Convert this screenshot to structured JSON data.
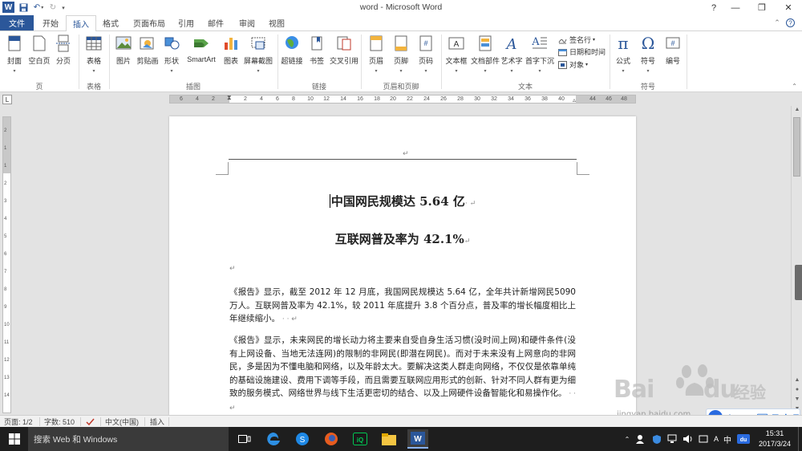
{
  "window": {
    "title": "word  -  Microsoft Word",
    "minimize": "—",
    "restore": "❐",
    "close": "✕",
    "help": "?"
  },
  "tabs": [
    "文件",
    "开始",
    "插入",
    "格式",
    "页面布局",
    "引用",
    "邮件",
    "审阅",
    "视图"
  ],
  "ribbon": {
    "groups": {
      "pages": "页",
      "tables": "表格",
      "illustrations": "插图",
      "links": "链接",
      "header_footer": "页眉和页脚",
      "text": "文本",
      "symbols": "符号"
    },
    "buttons": {
      "cover": "封面",
      "blank_page": "空白页",
      "page_break": "分页",
      "table": "表格",
      "picture": "图片",
      "clip_art": "剪贴画",
      "shapes": "形状",
      "smartart": "SmartArt",
      "chart": "图表",
      "screenshot": "屏幕截图",
      "hyperlink": "超链接",
      "bookmark": "书签",
      "cross_reference": "交叉引用",
      "header": "页眉",
      "footer": "页脚",
      "page_number": "页码",
      "text_box": "文本框",
      "quick_parts": "文档部件",
      "wordart": "艺术字",
      "drop_cap": "首字下沉",
      "signature_line": "签名行",
      "date_time": "日期和时间",
      "object": "对象",
      "equation": "公式",
      "symbol": "符号",
      "numbering": "编号"
    }
  },
  "ruler": {
    "h_ticks": [
      "6",
      "4",
      "2",
      "2",
      "4",
      "6",
      "8",
      "10",
      "12",
      "14",
      "16",
      "18",
      "20",
      "22",
      "24",
      "26",
      "28",
      "30",
      "32",
      "34",
      "36",
      "38",
      "40",
      "44",
      "46",
      "48"
    ],
    "v_ticks": [
      "2",
      "1",
      "1",
      "2",
      "3",
      "4",
      "5",
      "6",
      "7",
      "8",
      "9",
      "10",
      "11",
      "12",
      "13",
      "14"
    ]
  },
  "document": {
    "title": "中国网民规模达 5.64 亿",
    "subtitle": "互联网普及率为 42.1%",
    "para1": "《报告》显示，截至 2012 年 12 月底，我国网民规模达 5.64 亿，全年共计新增网民5090 万人。互联网普及率为 42.1%，较 2011 年底提升 3.8 个百分点，普及率的增长幅度相比上年继续缩小。",
    "para2": "《报告》显示，未来网民的增长动力将主要来自受自身生活习惯(没时间上网)和硬件条件(没有上网设备、当地无法连网)的限制的非网民(即潜在网民)。而对于未来没有上网意向的非网民，多是因为不懂电脑和网络，以及年龄太大。要解决这类人群走向网络，不仅仅是依靠单纯的基础设施建设、费用下调等手段，而且需要互联网应用形式的创新、针对不同人群有更为细致的服务模式、网络世界与线下生活更密切的结合、以及上网硬件设备智能化和易操作化。",
    "para_mark": "↵"
  },
  "status": {
    "page": "页面: 1/2",
    "words": "字数: 510",
    "language": "中文(中国)",
    "insert_mode": "插入"
  },
  "taskbar": {
    "search_placeholder": "搜索 Web 和 Windows",
    "time": "15:31",
    "date": "2017/3/24",
    "ime_lang": "中"
  },
  "watermark": {
    "main": "Bai",
    "du": "du",
    "jy": "经验",
    "sub": "jingyan.baidu.com"
  },
  "ime_bar": {
    "logo": "du",
    "lang": "中",
    "punct": "•,"
  },
  "colors": {
    "word_blue": "#2b579a",
    "taskbar": "#1e1e1e"
  }
}
